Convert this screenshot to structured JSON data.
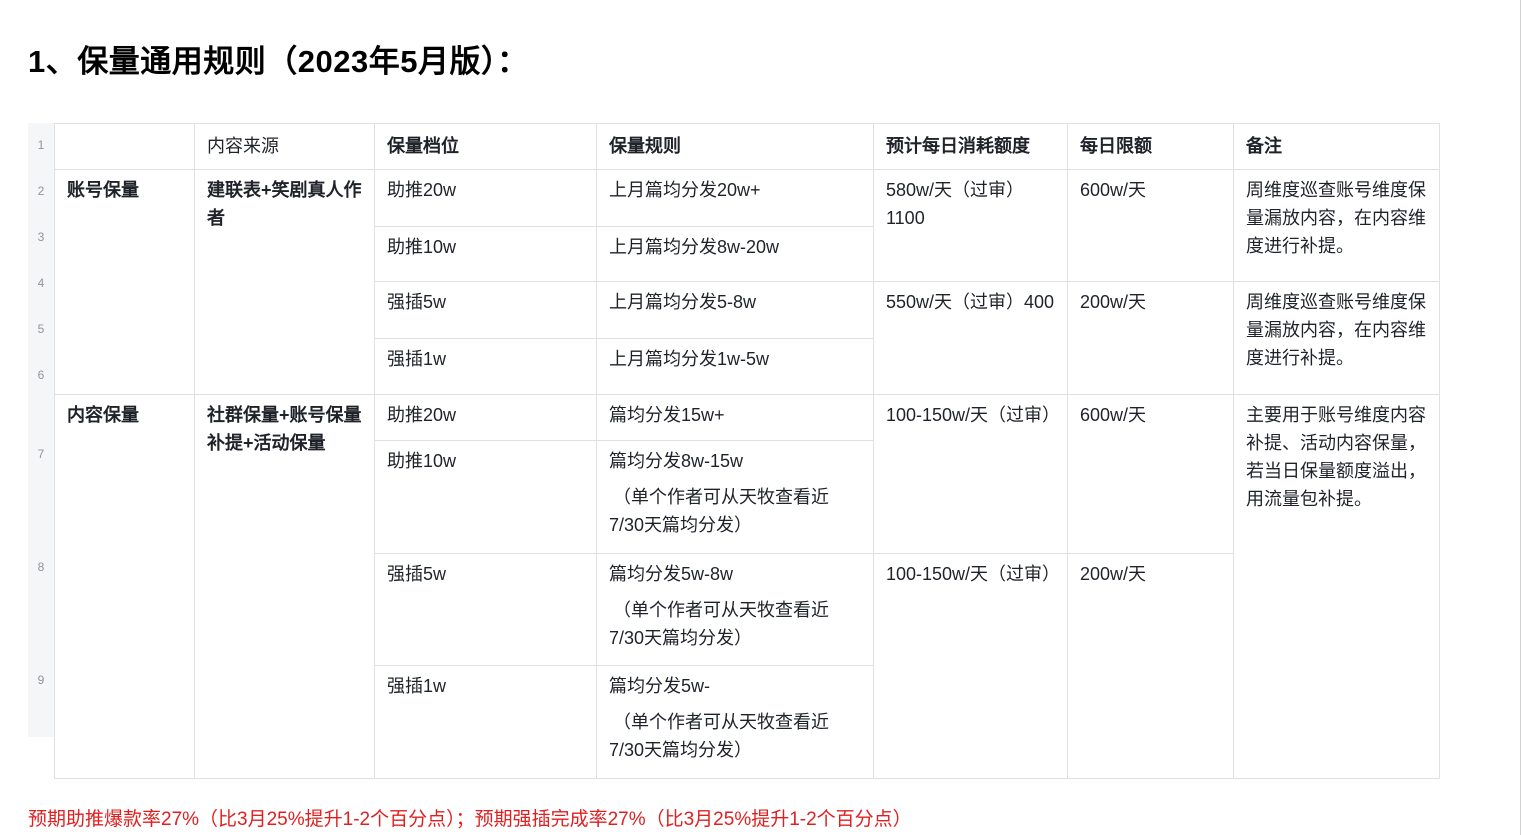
{
  "title": "1、保量通用规则（2023年5月版）：",
  "row_numbers": [
    "1",
    "2",
    "3",
    "4",
    "5",
    "6",
    "7",
    "8",
    "9"
  ],
  "headers": {
    "col1": "",
    "col2": "内容来源",
    "col3": "保量档位",
    "col4": "保量规则",
    "col5": "预计每日消耗额度",
    "col6": "每日限额",
    "col7": "备注"
  },
  "account": {
    "type": "账号保量",
    "source": "建联表+笑剧真人作者",
    "tiers": [
      "助推20w",
      "助推10w",
      "强插5w",
      "强插1w"
    ],
    "rules": [
      "上月篇均分发20w+",
      "上月篇均分发8w-20w",
      "上月篇均分发5-8w",
      "上月篇均分发1w-5w"
    ],
    "boost_quota": "580w/天（过审）1100",
    "boost_limit": "600w/天",
    "boost_note": "周维度巡查账号维度保量漏放内容，在内容维度进行补提。",
    "insert_quota": "550w/天（过审）400",
    "insert_limit": "200w/天",
    "insert_note": "周维度巡查账号维度保量漏放内容，在内容维度进行补提。"
  },
  "content": {
    "type": "内容保量",
    "source": "社群保量+账号保量补提+活动保量",
    "tiers": [
      "助推20w",
      "助推10w",
      "强插5w",
      "强插1w"
    ],
    "rules": [
      "篇均分发15w+",
      "篇均分发8w-15w",
      "篇均分发5w-8w",
      "篇均分发5w-"
    ],
    "rule_note_a": "（单个作者可从天牧查看近",
    "rule_note_b": "7/30天篇均分发）",
    "boost_quota": "100-150w/天（过审）",
    "boost_limit": "600w/天",
    "insert_quota": "100-150w/天（过审）",
    "insert_limit": "200w/天",
    "note": "主要用于账号维度内容补提、活动内容保量，若当日保量额度溢出，用流量包补提。"
  },
  "footnote": "预期助推爆款率27%（比3月25%提升1-2个百分点）；预期强插完成率27%（比3月25%提升1-2个百分点）"
}
